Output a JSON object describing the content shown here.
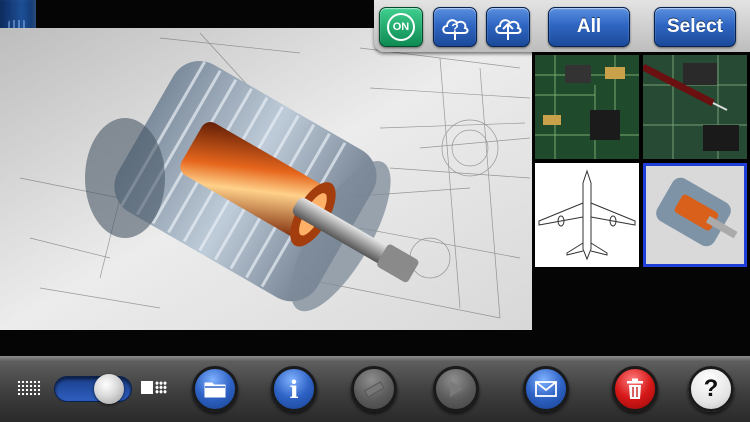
{
  "top_toolbar": {
    "on_button_label": "ON",
    "cloud_help_icon": "cloud-question-icon",
    "cloud_upload_icon": "cloud-upload-icon",
    "all_button_label": "All",
    "select_button_label": "Select"
  },
  "viewer": {
    "image": "electric-motor-cutaway",
    "icon": "motor-cutaway-image"
  },
  "thumbnails": [
    {
      "subject": "circuit-board-green",
      "selected": false
    },
    {
      "subject": "circuit-board-probe",
      "selected": false
    },
    {
      "subject": "airplane-blueprint",
      "selected": false
    },
    {
      "subject": "electric-motor-cutaway",
      "selected": true
    }
  ],
  "bottom_toolbar": {
    "thumbnail_size_slider_value": 0.85,
    "small_grid_icon": "grid-small-icon",
    "large_grid_icon": "grid-large-icon",
    "folder_icon": "folder-icon",
    "info_label": "i",
    "measure_icon": "ruler-icon",
    "play_icon": "play-icon",
    "mail_icon": "envelope-icon",
    "delete_icon": "trash-icon",
    "help_label": "?"
  },
  "colors": {
    "accent_blue": "#2f66c2",
    "on_green": "#17a264",
    "delete_red": "#d61818",
    "selection_blue": "#1f3fd8"
  }
}
